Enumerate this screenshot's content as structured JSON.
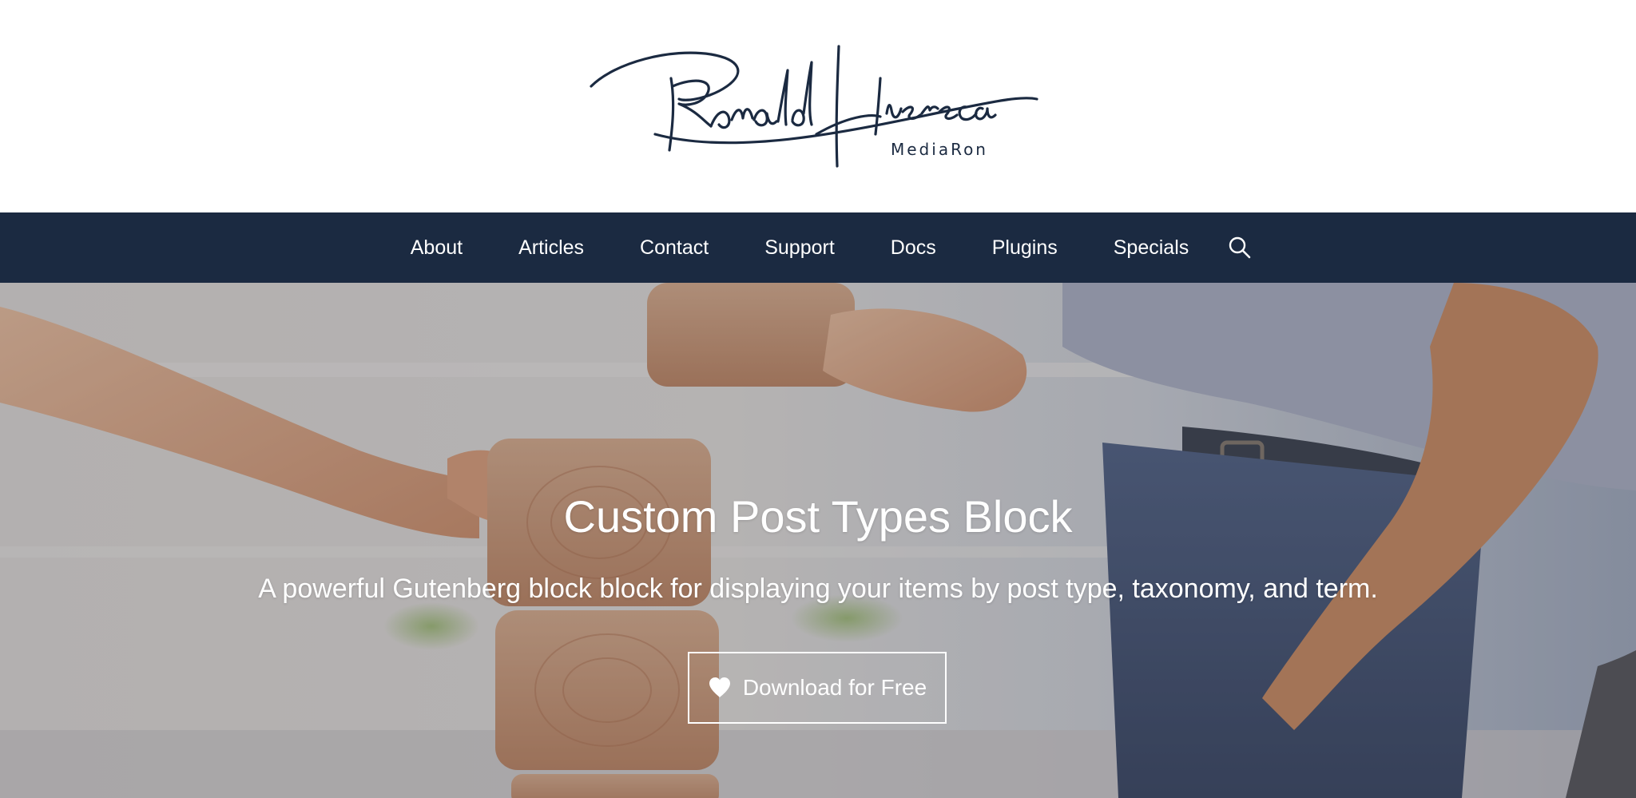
{
  "logo": {
    "name_script": "Ronald Huereca",
    "tagline": "MediaRon"
  },
  "nav": {
    "items": [
      {
        "label": "About",
        "key": "about"
      },
      {
        "label": "Articles",
        "key": "articles"
      },
      {
        "label": "Contact",
        "key": "contact"
      },
      {
        "label": "Support",
        "key": "support"
      },
      {
        "label": "Docs",
        "key": "docs"
      },
      {
        "label": "Plugins",
        "key": "plugins"
      },
      {
        "label": "Specials",
        "key": "specials"
      }
    ],
    "search_icon": "search-icon"
  },
  "hero": {
    "title": "Custom Post Types Block",
    "subtitle": "A powerful Gutenberg block block for displaying your items by post type, taxonomy, and term.",
    "cta_label": "Download for Free",
    "cta_icon": "heart-icon"
  },
  "colors": {
    "nav_bg": "#1b2a41",
    "logo_ink": "#1b2a41",
    "text_light": "#ffffff"
  }
}
